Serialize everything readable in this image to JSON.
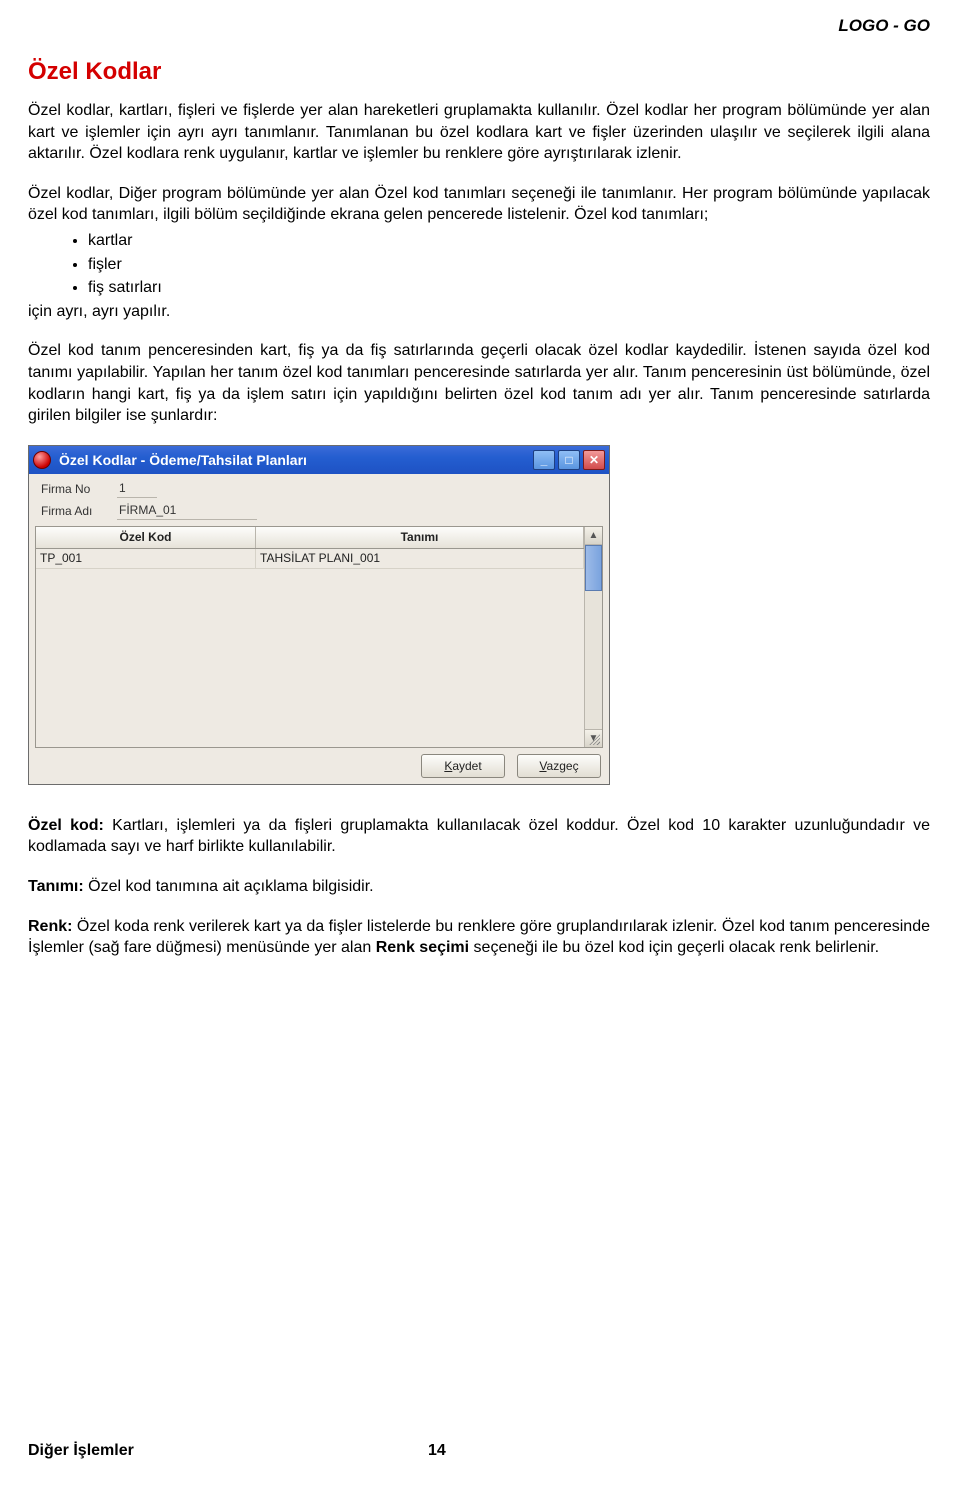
{
  "header": {
    "brand": "LOGO - GO"
  },
  "title": "Özel Kodlar",
  "paragraphs": {
    "p1": "Özel kodlar, kartları, fişleri ve fişlerde yer alan hareketleri gruplamakta kullanılır. Özel kodlar her program bölümünde yer alan kart ve işlemler için ayrı ayrı tanımlanır. Tanımlanan bu özel kodlara kart ve fişler üzerinden ulaşılır ve seçilerek ilgili alana aktarılır. Özel kodlara renk uygulanır, kartlar ve işlemler bu renklere göre ayrıştırılarak izlenir.",
    "p2": "Özel kodlar, Diğer program bölümünde yer alan Özel kod tanımları seçeneği ile tanımlanır. Her program bölümünde yapılacak özel kod tanımları, ilgili bölüm seçildiğinde ekrana gelen pencerede listelenir. Özel kod tanımları;",
    "bullets": [
      "kartlar",
      "fişler",
      "fiş satırları"
    ],
    "p2_after": "için ayrı, ayrı yapılır.",
    "p3": "Özel kod tanım penceresinden kart, fiş ya da fiş satırlarında geçerli olacak özel kodlar kaydedilir. İstenen sayıda özel kod tanımı yapılabilir. Yapılan her tanım özel kod tanımları penceresinde satırlarda yer alır. Tanım penceresinin üst bölümünde, özel kodların hangi kart, fiş ya da işlem satırı için yapıldığını belirten özel kod tanım adı yer alır. Tanım penceresinde satırlarda girilen bilgiler ise şunlardır:",
    "p4_label": "Özel kod:",
    "p4_text": " Kartları, işlemleri ya da fişleri gruplamakta kullanılacak özel koddur. Özel kod 10 karakter uzunluğundadır ve kodlamada sayı ve harf birlikte kullanılabilir.",
    "p5_label": "Tanımı:",
    "p5_text": "  Özel kod tanımına ait açıklama bilgisidir.",
    "p6_label": "Renk:",
    "p6_text_a": " Özel koda renk verilerek kart ya da fişler listelerde bu renklere göre gruplandırılarak izlenir. Özel kod tanım penceresinde İşlemler (sağ fare düğmesi) menüsünde yer alan ",
    "p6_bold": "Renk seçimi",
    "p6_text_b": " seçeneği ile bu özel kod için geçerli olacak renk belirlenir."
  },
  "dialog": {
    "title": "Özel Kodlar - Ödeme/Tahsilat Planları",
    "firma_no_label": "Firma No",
    "firma_no_value": "1",
    "firma_adi_label": "Firma Adı",
    "firma_adi_value": "FİRMA_01",
    "col_ozelkod": "Özel Kod",
    "col_tanimi": "Tanımı",
    "rows": [
      {
        "kod": "TP_001",
        "tanim": "TAHSİLAT PLANI_001"
      }
    ],
    "btn_save_u": "K",
    "btn_save_rest": "aydet",
    "btn_cancel_u": "V",
    "btn_cancel_rest": "azgeç"
  },
  "footer": {
    "left": "Diğer İşlemler",
    "page": "14"
  }
}
